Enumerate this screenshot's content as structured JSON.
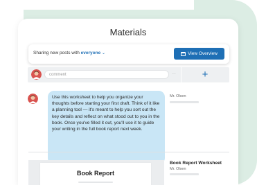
{
  "header": {
    "title": "Materials"
  },
  "share": {
    "prefix": "Sharing new posts with",
    "audience": "everyone",
    "view_button": "View Overview"
  },
  "composer": {
    "placeholder": "comment",
    "plus_label": "+"
  },
  "post": {
    "author": "Mr. Olsen",
    "message": "Use this worksheet to help you organize your thoughts before starting your first draft. Think of it like a planning tool — it's meant to help you sort out the key details and reflect on what stood out to you in the book. Once you've filled it out, you'll use it to guide your writing in the full book report next week."
  },
  "attachment": {
    "page_title": "Book Report",
    "title": "Book Report Worksheet",
    "author": "Mr. Olsen"
  },
  "colors": {
    "accent": "#1e6fb5",
    "bubble": "#c9e6f6",
    "background_blob": "#dcede4"
  }
}
